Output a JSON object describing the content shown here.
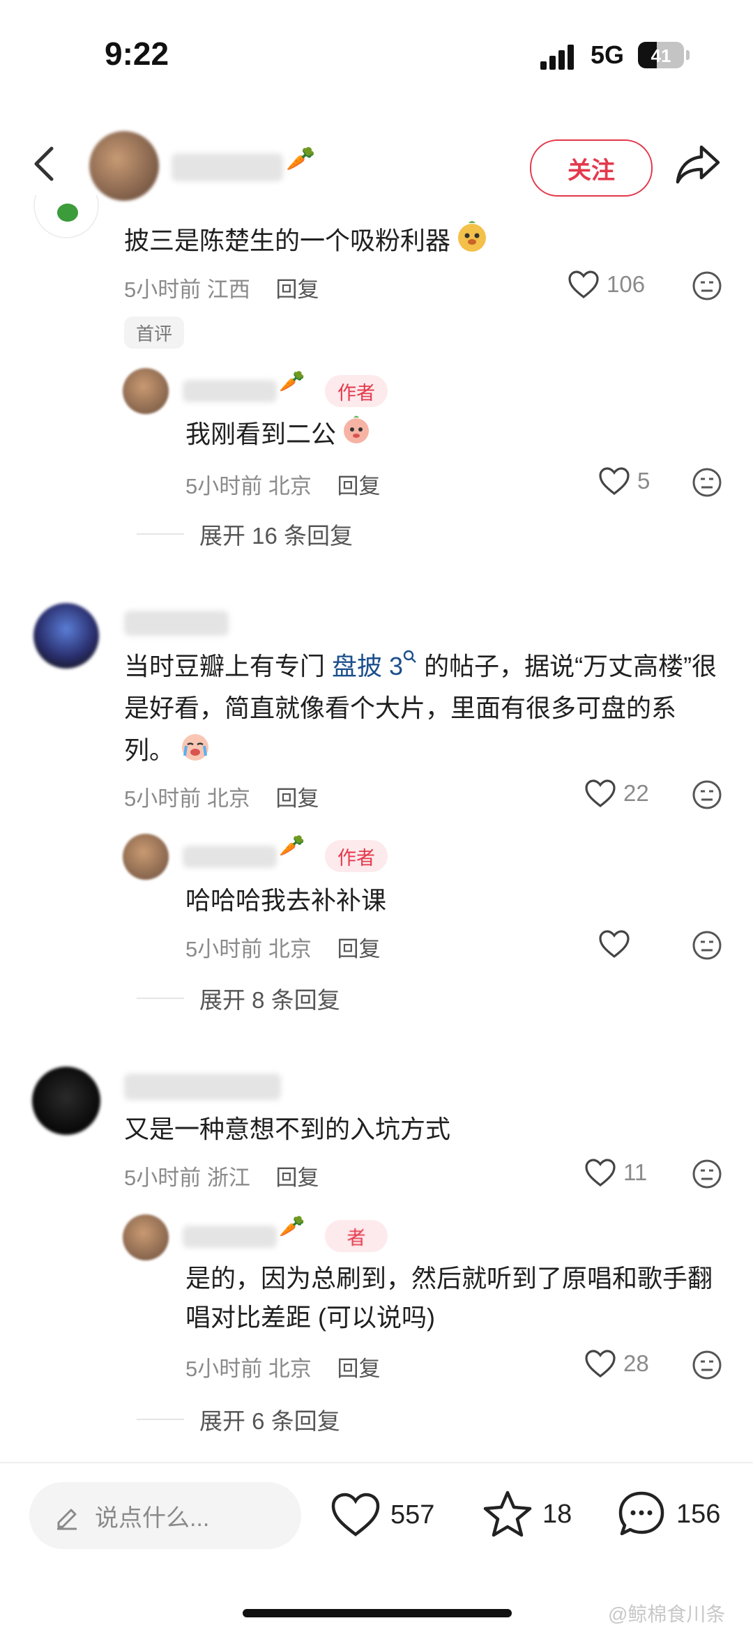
{
  "status_bar": {
    "time": "9:22",
    "network": "5G",
    "battery": "41",
    "battery_level": 0.41
  },
  "header": {
    "follow_label": "关注",
    "icons": [
      "back-icon",
      "share-icon"
    ]
  },
  "comments": [
    {
      "text": "披三是陈楚生的一个吸粉利器",
      "time": "5小时前",
      "location": "江西",
      "reply_label": "回复",
      "likes": "106",
      "badge": "首评",
      "author_reply": {
        "tag": "作者",
        "text": "我刚看到二公",
        "time": "5小时前",
        "location": "北京",
        "reply_label": "回复",
        "likes": "5"
      },
      "expand": "展开 16 条回复"
    },
    {
      "text_before": "当时豆瓣上有专门",
      "link_text": "盘披 3",
      "text_after": "的帖子，据说“万丈高楼”很是好看，简直就像看个大片，里面有很多可盘的系列。",
      "time": "5小时前",
      "location": "北京",
      "reply_label": "回复",
      "likes": "22",
      "author_reply": {
        "tag": "作者",
        "text": "哈哈哈我去补补课",
        "time": "5小时前",
        "location": "北京",
        "reply_label": "回复"
      },
      "expand": "展开 8 条回复"
    },
    {
      "text": "又是一种意想不到的入坑方式",
      "time": "5小时前",
      "location": "浙江",
      "reply_label": "回复",
      "likes": "11",
      "author_reply": {
        "tag": "者",
        "text": "是的，因为总刷到，然后就听到了原唱和歌手翻唱对比差距 (可以说吗)",
        "time": "5小时前",
        "location": "北京",
        "reply_label": "回复",
        "likes": "28"
      },
      "expand": "展开 6 条回复"
    }
  ],
  "bottom_bar": {
    "placeholder": "说点什么...",
    "likes": "557",
    "stars": "18",
    "comments": "156"
  },
  "watermark": "@鲸棉食川条"
}
